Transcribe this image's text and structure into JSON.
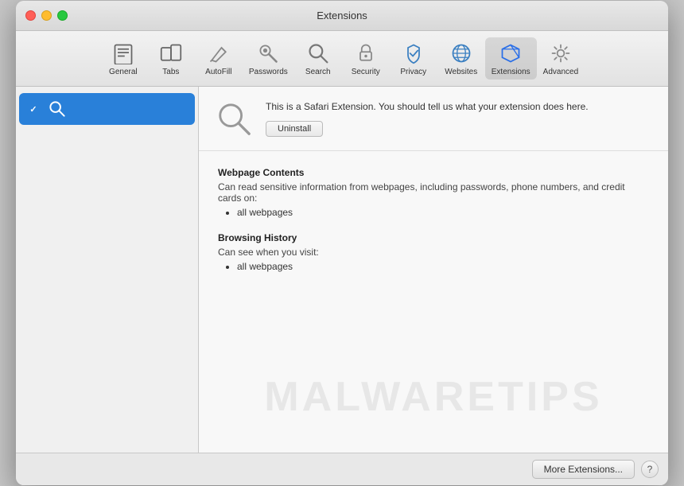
{
  "window": {
    "title": "Extensions"
  },
  "titlebar": {
    "title": "Extensions",
    "buttons": {
      "close_label": "",
      "min_label": "",
      "max_label": ""
    }
  },
  "toolbar": {
    "items": [
      {
        "id": "general",
        "label": "General",
        "icon": "📄"
      },
      {
        "id": "tabs",
        "label": "Tabs",
        "icon": "🗂"
      },
      {
        "id": "autofill",
        "label": "AutoFill",
        "icon": "✏️"
      },
      {
        "id": "passwords",
        "label": "Passwords",
        "icon": "🔑"
      },
      {
        "id": "search",
        "label": "Search",
        "icon": "🔍"
      },
      {
        "id": "security",
        "label": "Security",
        "icon": "🛡"
      },
      {
        "id": "privacy",
        "label": "Privacy",
        "icon": "✋"
      },
      {
        "id": "websites",
        "label": "Websites",
        "icon": "🌐"
      },
      {
        "id": "extensions",
        "label": "Extensions",
        "icon": "⚡"
      },
      {
        "id": "advanced",
        "label": "Advanced",
        "icon": "⚙️"
      }
    ]
  },
  "sidebar": {
    "items": [
      {
        "id": "search-ext",
        "checked": true,
        "label": "",
        "icon": "search"
      }
    ]
  },
  "detail": {
    "icon": "search",
    "description": "This is a Safari Extension. You should tell us what your extension does here.",
    "uninstall_label": "Uninstall",
    "permissions": [
      {
        "title": "Webpage Contents",
        "desc": "Can read sensitive information from webpages, including passwords, phone numbers, and credit cards on:",
        "items": [
          "all webpages"
        ]
      },
      {
        "title": "Browsing History",
        "desc": "Can see when you visit:",
        "items": [
          "all webpages"
        ]
      }
    ]
  },
  "footer": {
    "more_extensions_label": "More Extensions...",
    "help_label": "?"
  },
  "watermark": {
    "text": "MALWARETIPS"
  }
}
